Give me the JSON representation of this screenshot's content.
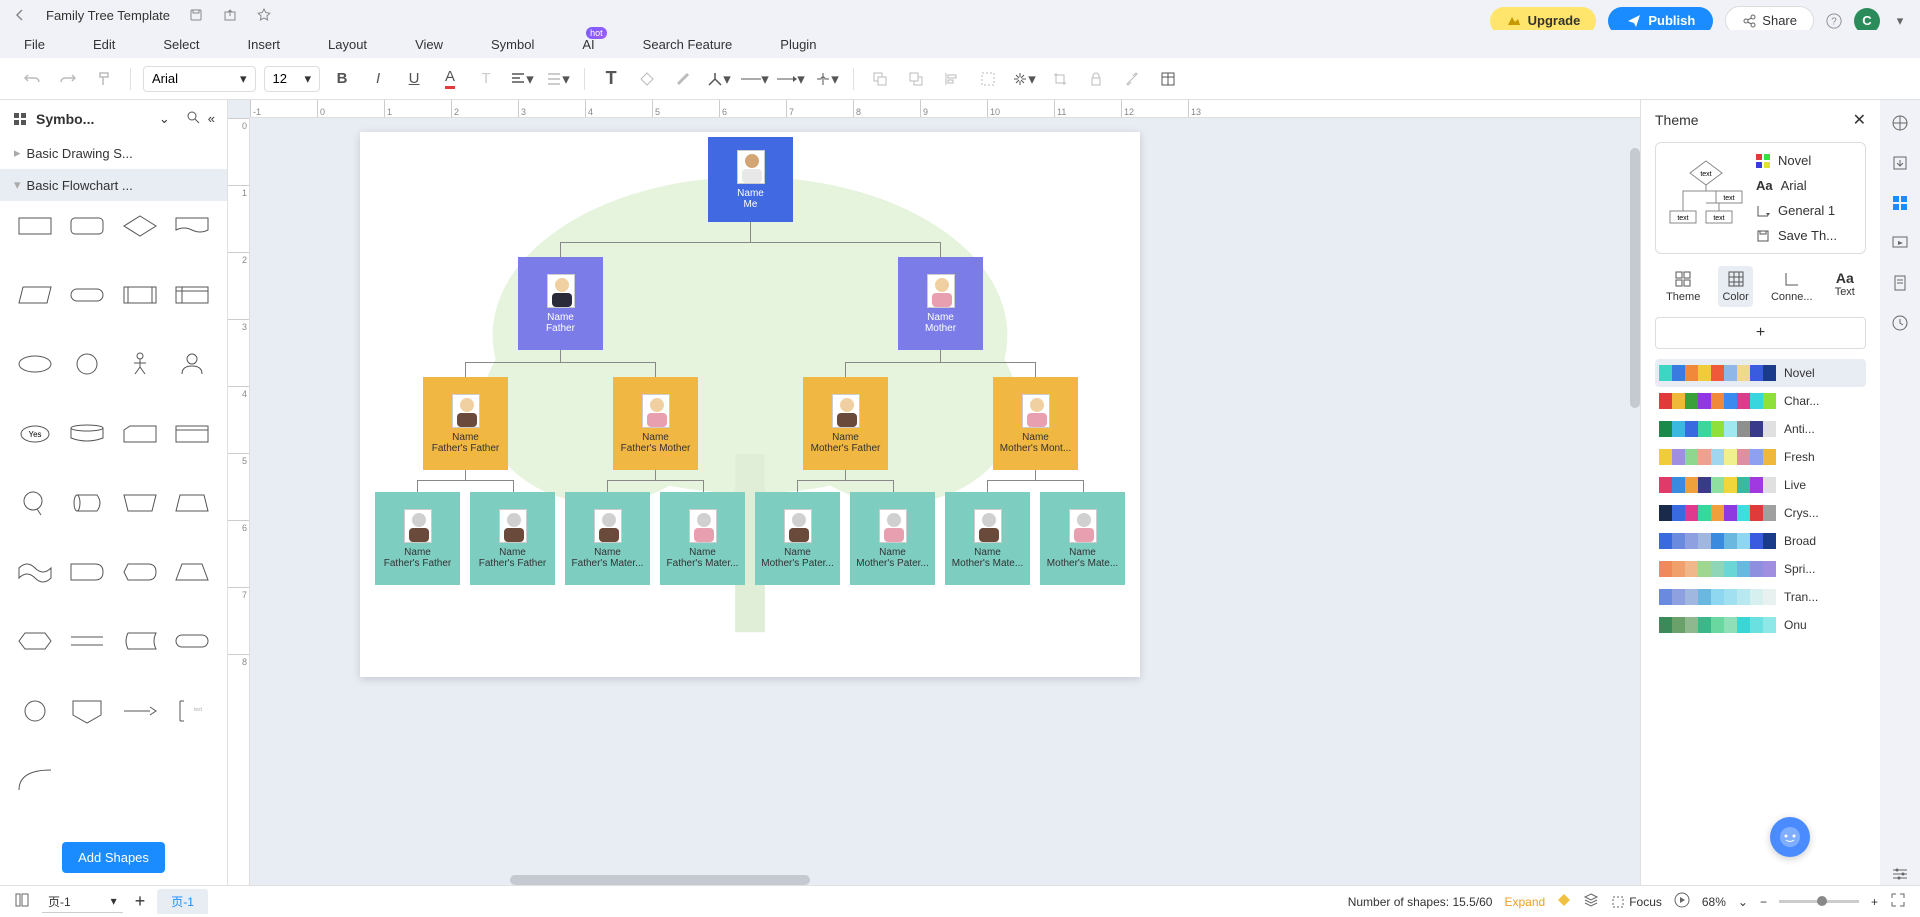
{
  "title_bar": {
    "doc_title": "Family Tree Template"
  },
  "menu": {
    "file": "File",
    "edit": "Edit",
    "select": "Select",
    "insert": "Insert",
    "layout": "Layout",
    "view": "View",
    "symbol": "Symbol",
    "ai": "AI",
    "ai_badge": "hot",
    "search": "Search Feature",
    "plugin": "Plugin"
  },
  "header": {
    "upgrade": "Upgrade",
    "publish": "Publish",
    "share": "Share",
    "avatar": "C"
  },
  "toolbar": {
    "font": "Arial",
    "size": "12"
  },
  "left_panel": {
    "title": "Symbo...",
    "cat1": "Basic Drawing S...",
    "cat2": "Basic Flowchart ...",
    "add": "Add Shapes",
    "yes": "Yes"
  },
  "ruler_h": [
    "-1",
    "0",
    "1",
    "2",
    "3",
    "4",
    "5",
    "6",
    "7",
    "8",
    "9",
    "10",
    "11",
    "12",
    "13"
  ],
  "ruler_v": [
    "0",
    "1",
    "2",
    "3",
    "4",
    "5",
    "6",
    "7",
    "8"
  ],
  "tree": {
    "me": {
      "name": "Name",
      "rel": "Me"
    },
    "father": {
      "name": "Name",
      "rel": "Father"
    },
    "mother": {
      "name": "Name",
      "rel": "Mother"
    },
    "ff": {
      "name": "Name",
      "rel": "Father's Father"
    },
    "fm": {
      "name": "Name",
      "rel": "Father's Mother"
    },
    "mf": {
      "name": "Name",
      "rel": "Mother's Father"
    },
    "mm": {
      "name": "Name",
      "rel": "Mother's Mont..."
    },
    "l1": {
      "name": "Name",
      "rel": "Father's Father"
    },
    "l2": {
      "name": "Name",
      "rel": "Father's Father"
    },
    "l3": {
      "name": "Name",
      "rel": "Father's Mater..."
    },
    "l4": {
      "name": "Name",
      "rel": "Father's Mater..."
    },
    "l5": {
      "name": "Name",
      "rel": "Mother's Pater..."
    },
    "l6": {
      "name": "Name",
      "rel": "Mother's Pater..."
    },
    "l7": {
      "name": "Name",
      "rel": "Mother's Mate..."
    },
    "l8": {
      "name": "Name",
      "rel": "Mother's Mate..."
    }
  },
  "theme_panel": {
    "title": "Theme",
    "novel": "Novel",
    "font": "Arial",
    "conn": "General 1",
    "save": "Save Th...",
    "tabs": {
      "theme": "Theme",
      "color": "Color",
      "conn": "Conne...",
      "text": "Text"
    },
    "themes": [
      {
        "name": "Novel",
        "colors": [
          "#3dd6c4",
          "#3a7be0",
          "#f08a3a",
          "#f0cc3a",
          "#f05a3a",
          "#8fb8e8",
          "#f0d88f",
          "#3a5ae0",
          "#1a3a8a"
        ]
      },
      {
        "name": "Char...",
        "colors": [
          "#e03a3a",
          "#f0b83a",
          "#3aa03a",
          "#8f3ae0",
          "#f08a3a",
          "#3a8af0",
          "#e03a8f",
          "#3ad6e0",
          "#8fe03a"
        ]
      },
      {
        "name": "Anti...",
        "colors": [
          "#1a8a4a",
          "#3ab8e0",
          "#3a6ae0",
          "#3ad6a0",
          "#8fe03a",
          "#a0e8f0",
          "#8f8f8f",
          "#3a3a8a",
          "#e0e0e0"
        ]
      },
      {
        "name": "Fresh",
        "colors": [
          "#f0cc3a",
          "#a08fe0",
          "#8fd68f",
          "#f0a08f",
          "#a0d6f0",
          "#f0f08f",
          "#e08fa0",
          "#8fa0f0",
          "#f0b83a"
        ]
      },
      {
        "name": "Live",
        "colors": [
          "#e03a6a",
          "#3a8ae0",
          "#f0a03a",
          "#3a3a8a",
          "#8fe0a0",
          "#f0d63a",
          "#3ab8a0",
          "#a03ae0",
          "#e0e0e0"
        ]
      },
      {
        "name": "Crys...",
        "colors": [
          "#1a2a4a",
          "#3a6ae0",
          "#e03a8f",
          "#3ad6a0",
          "#f0a03a",
          "#8f3ae0",
          "#3ae0e0",
          "#e03a3a",
          "#a0a0a0"
        ]
      },
      {
        "name": "Broad",
        "colors": [
          "#3a6ae0",
          "#6a8ae0",
          "#8fa0e0",
          "#a0b8e0",
          "#3a8ae0",
          "#6ab8e0",
          "#8fd6f0",
          "#3a5ae0",
          "#1a3a8a"
        ]
      },
      {
        "name": "Spri...",
        "colors": [
          "#f08a5a",
          "#f0a06a",
          "#f0b88a",
          "#a0d68f",
          "#8fd6b8",
          "#6ad6d6",
          "#6ab8e0",
          "#8f8fe0",
          "#a08fe0"
        ]
      },
      {
        "name": "Tran...",
        "colors": [
          "#6a8ae0",
          "#8fa0e0",
          "#a0b8e0",
          "#6ab8e0",
          "#8fd6f0",
          "#a0e0f0",
          "#b8e8f0",
          "#d6f0f0",
          "#e8f0f0"
        ]
      },
      {
        "name": "Onu",
        "colors": [
          "#3a8a5a",
          "#6aa06a",
          "#8fb88f",
          "#3ab88a",
          "#6ad6a0",
          "#8fe0b8",
          "#3ad6d6",
          "#6ae0e0",
          "#8fe8e8"
        ]
      }
    ]
  },
  "status": {
    "page_dd": "页-1",
    "page_tab": "页-1",
    "shapes": "Number of shapes: 15.5/60",
    "expand": "Expand",
    "focus": "Focus",
    "zoom": "68%"
  },
  "tp_text": "text"
}
